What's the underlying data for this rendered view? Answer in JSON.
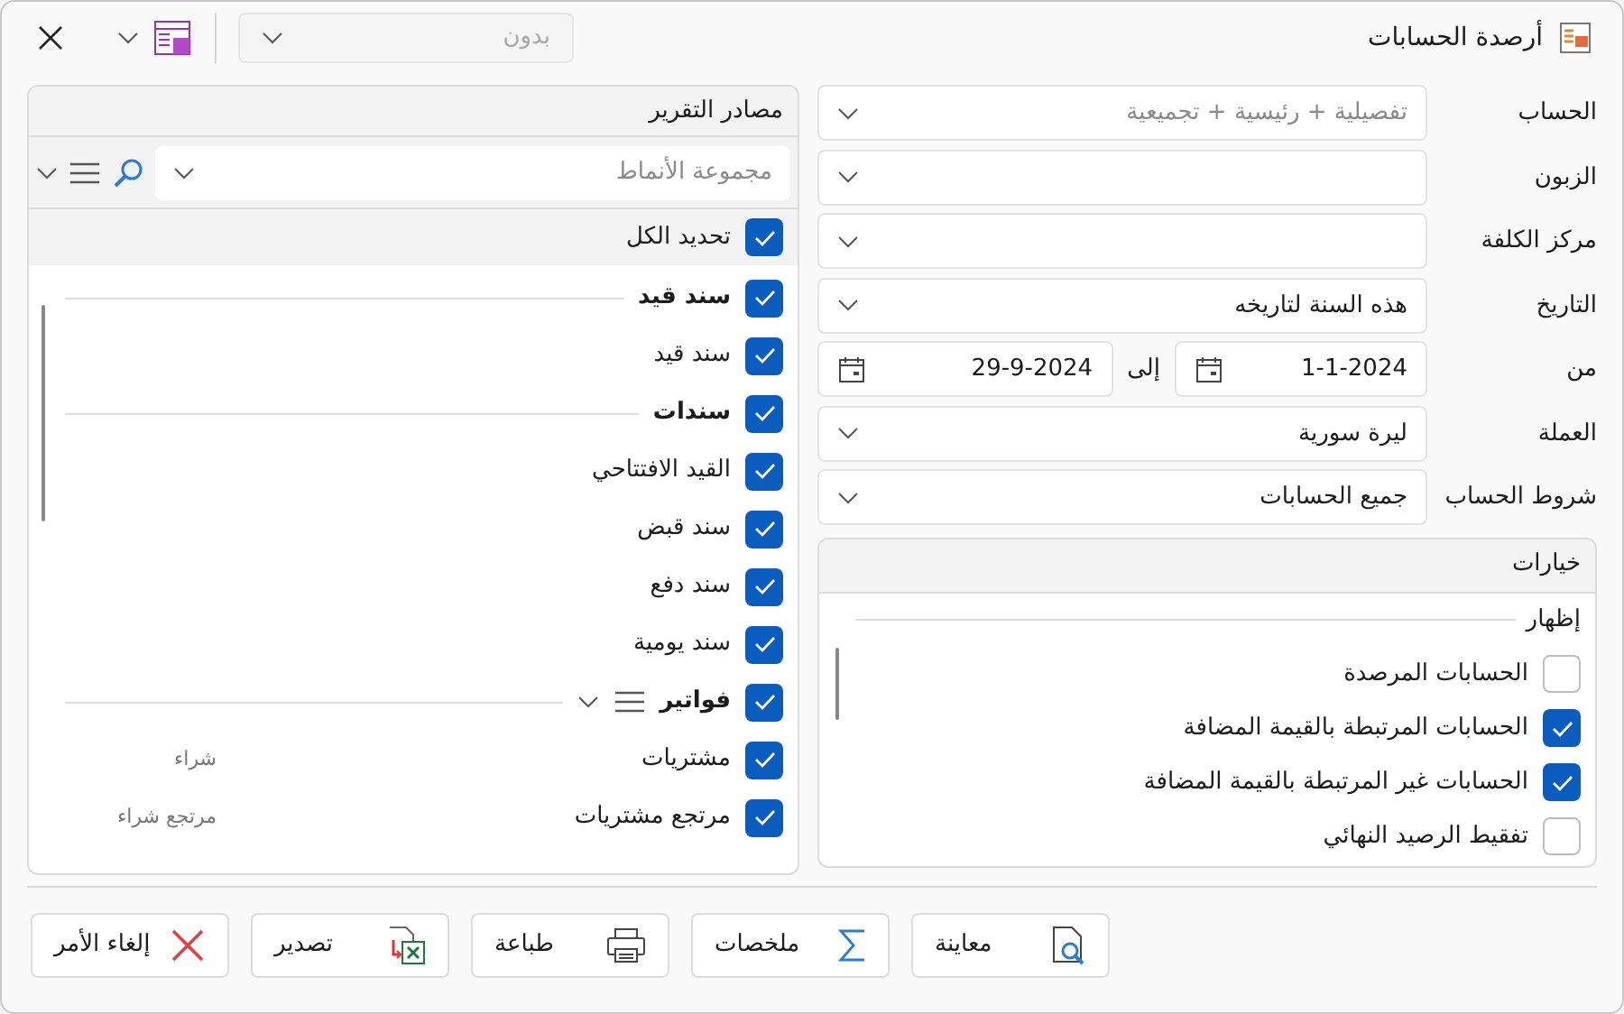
{
  "window": {
    "title": "أرصدة الحسابات"
  },
  "toolbar": {
    "style_select": {
      "value": "بدون",
      "disabled": true
    }
  },
  "fields": [
    {
      "kind": "select",
      "label": "الحساب",
      "placeholder": "تفصيلية + رئيسية + تجميعية"
    },
    {
      "kind": "select",
      "label": "الزبون"
    },
    {
      "kind": "select",
      "label": "مركز الكلفة"
    },
    {
      "kind": "select",
      "label": "التاريخ",
      "value": "هذه السنة لتاريخه"
    },
    {
      "kind": "date_range",
      "label": "من",
      "value": "1-1-2024",
      "to_label": "إلى",
      "to_value": "29-9-2024"
    },
    {
      "kind": "select",
      "label": "العملة",
      "value": "ليرة سورية"
    },
    {
      "kind": "select",
      "label": "شروط الحساب",
      "value": "جميع الحسابات"
    }
  ],
  "options": {
    "title": "خيارات",
    "group": "إظهار",
    "items": [
      {
        "label": "الحسابات المرصدة",
        "checked": false
      },
      {
        "label": "الحسابات المرتبطة بالقيمة المضافة",
        "checked": true
      },
      {
        "label": "الحسابات غير المرتبطة بالقيمة المضافة",
        "checked": true
      },
      {
        "label": "تفقيط الرصيد النهائي",
        "checked": false
      }
    ]
  },
  "sources": {
    "title": "مصادر التقرير",
    "filter": {
      "placeholder": "مجموعة الأنماط"
    },
    "select_all": {
      "label": "تحديد الكل",
      "checked": true
    },
    "items": [
      {
        "kind": "group",
        "label": "سند قيد",
        "checked": true
      },
      {
        "kind": "item",
        "label": "سند قيد",
        "checked": true
      },
      {
        "kind": "group",
        "label": "سندات",
        "checked": true
      },
      {
        "kind": "item",
        "label": "القيد الافتتاحي",
        "checked": true
      },
      {
        "kind": "item",
        "label": "سند قبض",
        "checked": true
      },
      {
        "kind": "item",
        "label": "سند دفع",
        "checked": true
      },
      {
        "kind": "item",
        "label": "سند يومية",
        "checked": true
      },
      {
        "kind": "group_menu",
        "label": "فواتير",
        "checked": true
      },
      {
        "kind": "item",
        "label": "مشتريات",
        "checked": true,
        "note": "شراء"
      },
      {
        "kind": "item",
        "label": "مرتجع مشتريات",
        "checked": true,
        "note": "مرتجع شراء"
      }
    ]
  },
  "buttons": [
    {
      "kind": "preview",
      "label": "معاينة"
    },
    {
      "kind": "sum",
      "label": "ملخصات"
    },
    {
      "kind": "print",
      "label": "طباعة"
    },
    {
      "kind": "export",
      "label": "تصدير"
    },
    {
      "kind": "cancel",
      "label": "إلغاء الأمر"
    }
  ]
}
